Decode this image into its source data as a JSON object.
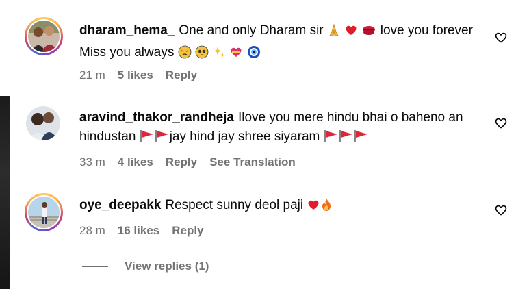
{
  "comments": [
    {
      "username": "dharam_hema_",
      "text_a": "One and only Dharam sir",
      "text_b": "love you forever Miss you always",
      "time": "21 m",
      "likes": "5 likes",
      "reply": "Reply"
    },
    {
      "username": "aravind_thakor_randheja",
      "text_a": "Ilove you mere hindu bhai o baheno an hindustan",
      "text_b": "jay hind jay shree siyaram",
      "time": "33 m",
      "likes": "4 likes",
      "reply": "Reply",
      "translation": "See Translation"
    },
    {
      "username": "oye_deepakk",
      "text_a": "Respect sunny deol paji",
      "time": "28 m",
      "likes": "16 likes",
      "reply": "Reply"
    }
  ],
  "view_replies": "View replies (1)",
  "icons": {
    "like": "heart-outline-icon",
    "flag": "red-flag-emoji",
    "heart": "red-heart-emoji"
  },
  "colors": {
    "meta_text": "#737373",
    "flag_red": "#e0243a",
    "heart_red": "#e11d2b"
  }
}
